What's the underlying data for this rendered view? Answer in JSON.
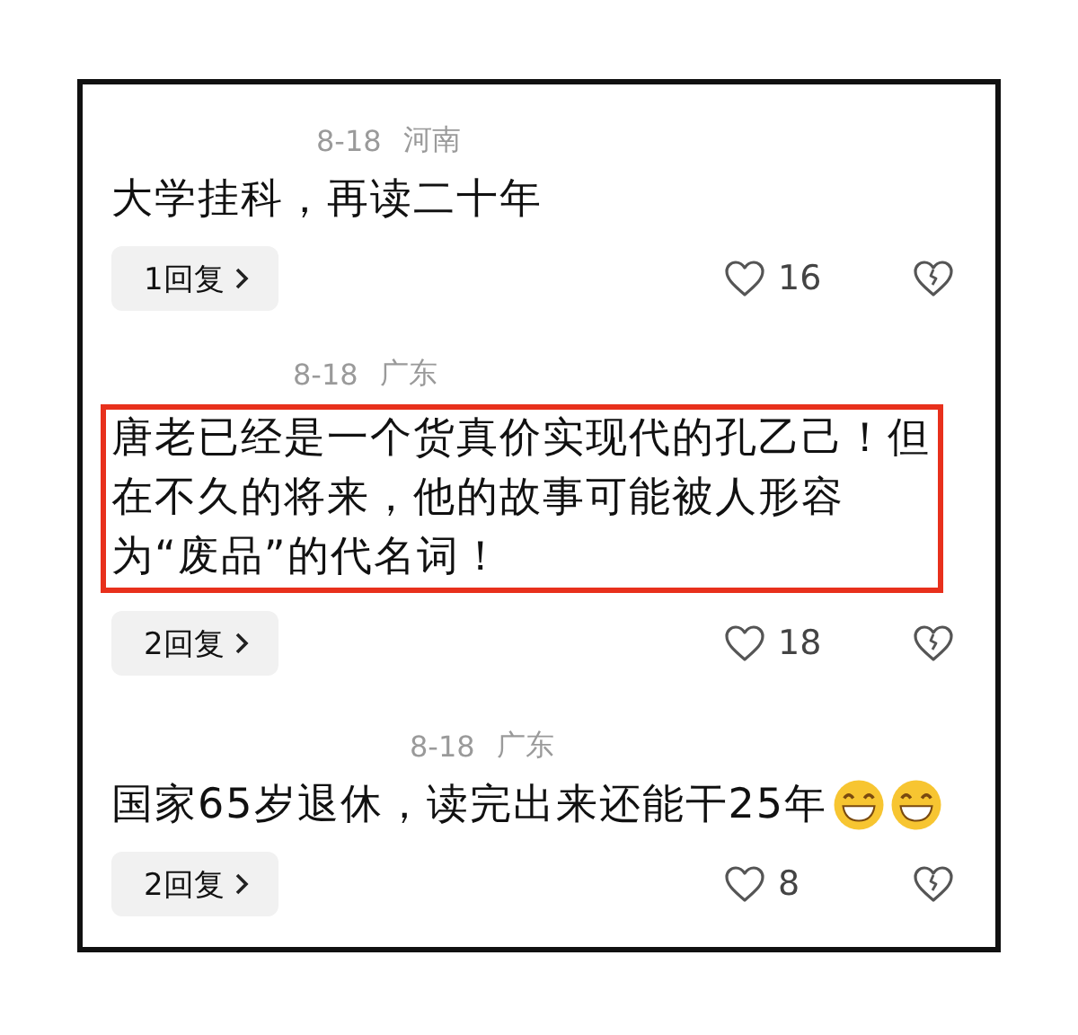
{
  "comments": [
    {
      "date": "8-18",
      "region": "河南",
      "text": "大学挂科，再读二十年",
      "highlighted": false,
      "replies": "1回复",
      "likes": "16"
    },
    {
      "date": "8-18",
      "region": "广东",
      "text": "唐老已经是一个货真价实现代的孔乙己！但在不久的将来，他的故事可能被人形容为“废品”的代名词！",
      "highlighted": true,
      "replies": "2回复",
      "likes": "18"
    },
    {
      "date": "8-18",
      "region": "广东",
      "text": "国家65岁退休，读完出来还能干25年",
      "highlighted": false,
      "emojis": [
        {
          "kind": "grin"
        },
        {
          "kind": "grin"
        }
      ],
      "replies": "2回复",
      "likes": "8"
    }
  ]
}
